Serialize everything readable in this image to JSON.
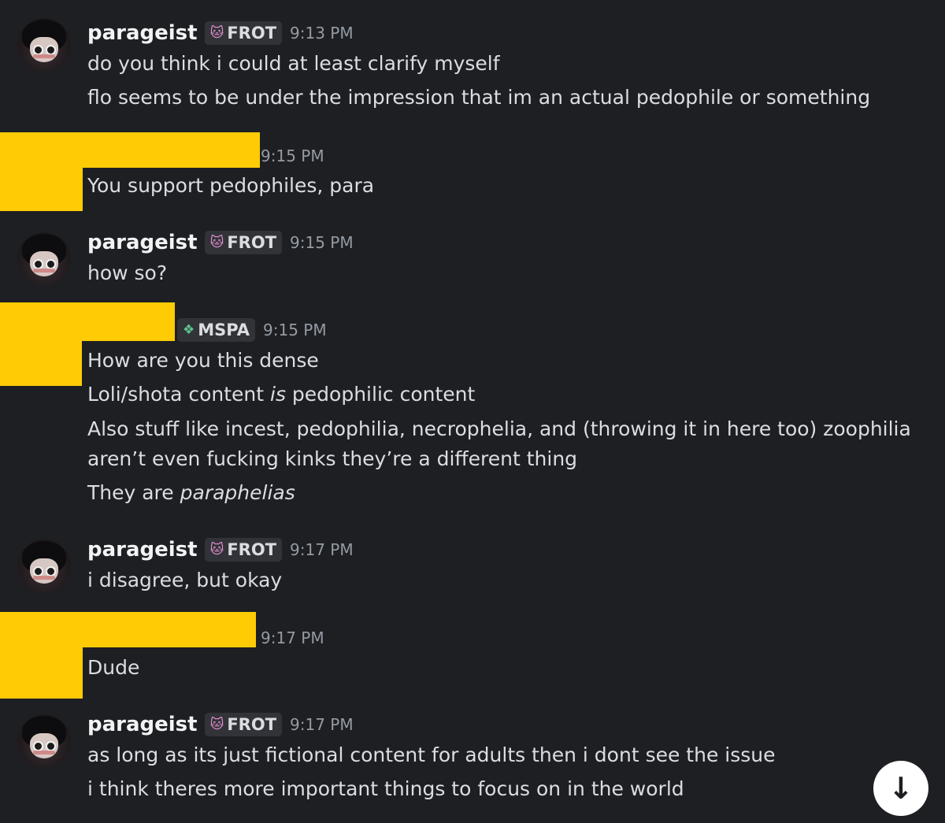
{
  "messages": [
    {
      "username": "parageist",
      "tag": "FROT",
      "tag_icon": "cat-icon",
      "time": "9:13 PM",
      "lines": [
        "do you think i could at least clarify myself",
        "flo seems to be under the impression that im an actual pedophile or something"
      ]
    },
    {
      "username": "",
      "time": "9:15 PM",
      "lines": [
        "You support pedophiles, para"
      ]
    },
    {
      "username": "parageist",
      "tag": "FROT",
      "tag_icon": "cat-icon",
      "time": "9:15 PM",
      "lines": [
        "how so?"
      ]
    },
    {
      "username": "",
      "tag": "MSPA",
      "tag_icon": "sparkle-icon",
      "time": "9:15 PM",
      "lines": [
        "How are you this dense",
        {
          "before": "Loli/shota content ",
          "italic": "is",
          "after": " pedophilic content"
        },
        "Also stuff like incest, pedophilia, necrophelia, and (throwing it in here too) zoophilia",
        "aren’t even fucking kinks they’re a different thing",
        {
          "before": "They are ",
          "italic": "paraphelias",
          "after": ""
        }
      ]
    },
    {
      "username": "parageist",
      "tag": "FROT",
      "tag_icon": "cat-icon",
      "time": "9:17 PM",
      "lines": [
        "i disagree, but okay"
      ]
    },
    {
      "username": "",
      "time": "9:17 PM",
      "lines": [
        "Dude"
      ]
    },
    {
      "username": "parageist",
      "tag": "FROT",
      "tag_icon": "cat-icon",
      "time": "9:17 PM",
      "lines": [
        "as long as its just fictional content for adults then i dont see the issue",
        "i think theres more important things to focus on in the world"
      ]
    }
  ],
  "scroll_button": {
    "icon": "arrow-down-icon",
    "glyph": "↓"
  },
  "colors": {
    "background": "#1e1f22",
    "text": "#dbdee1",
    "username": "#f2f3f5",
    "timestamp": "#949ba4",
    "redaction": "#ffcb05"
  }
}
